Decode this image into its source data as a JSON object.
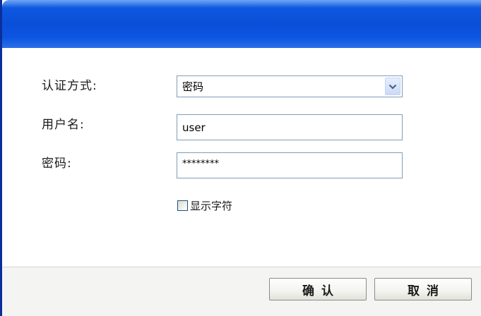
{
  "form": {
    "auth_method": {
      "label": "认证方式:",
      "selected": "密码"
    },
    "username": {
      "label": "用户名:",
      "value": "user"
    },
    "password": {
      "label": "密码:",
      "value": "********"
    },
    "show_chars": {
      "label": "显示字符",
      "checked": false
    }
  },
  "footer": {
    "confirm_label": "确认",
    "cancel_label": "取消"
  },
  "colors": {
    "titlebar": "#0a4fd8",
    "field_border": "#7f9db9",
    "footer_bg": "#f4f4f3"
  },
  "icons": {
    "dropdown": "chevron-down-icon"
  }
}
